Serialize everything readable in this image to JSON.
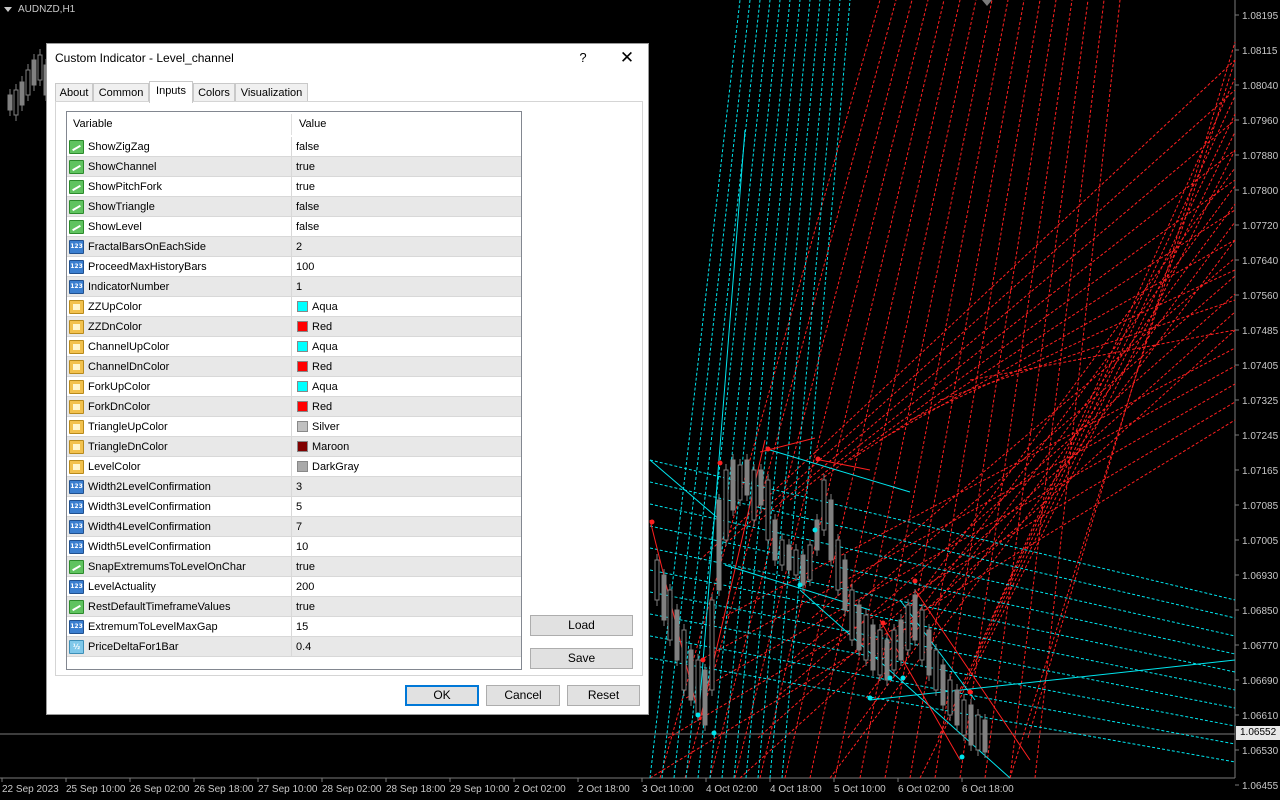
{
  "chart": {
    "symbol": "AUDNZD,H1",
    "current_price": "1.06552",
    "price_labels": [
      "1.08195",
      "1.08115",
      "1.08040",
      "1.07960",
      "1.07880",
      "1.07800",
      "1.07720",
      "1.07640",
      "1.07560",
      "1.07485",
      "1.07405",
      "1.07325",
      "1.07245",
      "1.07165",
      "1.07085",
      "1.07005",
      "1.06930",
      "1.06850",
      "1.06770",
      "1.06690",
      "1.06610",
      "1.06530",
      "1.06455"
    ],
    "time_labels": [
      "22 Sep 2023",
      "25 Sep 10:00",
      "26 Sep 02:00",
      "26 Sep 18:00",
      "27 Sep 10:00",
      "28 Sep 02:00",
      "28 Sep 18:00",
      "29 Sep 10:00",
      "2 Oct 02:00",
      "2 Oct 18:00",
      "3 Oct 10:00",
      "4 Oct 02:00",
      "4 Oct 18:00",
      "5 Oct 10:00",
      "6 Oct 02:00",
      "6 Oct 18:00"
    ],
    "colors": {
      "up": "#00e5ee",
      "down": "#ff2020",
      "candle": "#808080",
      "background": "#000000"
    }
  },
  "dialog": {
    "title": "Custom Indicator - Level_channel",
    "help": "?",
    "close": "✕",
    "tabs": [
      "About",
      "Common",
      "Inputs",
      "Colors",
      "Visualization"
    ],
    "active_tab": "Inputs",
    "grid": {
      "col_variable": "Variable",
      "col_value": "Value",
      "rows": [
        {
          "type": "bool",
          "name": "ShowZigZag",
          "value": "false"
        },
        {
          "type": "bool",
          "name": "ShowChannel",
          "value": "true"
        },
        {
          "type": "bool",
          "name": "ShowPitchFork",
          "value": "true"
        },
        {
          "type": "bool",
          "name": "ShowTriangle",
          "value": "false"
        },
        {
          "type": "bool",
          "name": "ShowLevel",
          "value": "false"
        },
        {
          "type": "int",
          "name": "FractalBarsOnEachSide",
          "value": "2"
        },
        {
          "type": "int",
          "name": "ProceedMaxHistoryBars",
          "value": "100"
        },
        {
          "type": "int",
          "name": "IndicatorNumber",
          "value": "1"
        },
        {
          "type": "color",
          "name": "ZZUpColor",
          "value": "Aqua",
          "swatch": "#00ffff"
        },
        {
          "type": "color",
          "name": "ZZDnColor",
          "value": "Red",
          "swatch": "#ff0000"
        },
        {
          "type": "color",
          "name": "ChannelUpColor",
          "value": "Aqua",
          "swatch": "#00ffff"
        },
        {
          "type": "color",
          "name": "ChannelDnColor",
          "value": "Red",
          "swatch": "#ff0000"
        },
        {
          "type": "color",
          "name": "ForkUpColor",
          "value": "Aqua",
          "swatch": "#00ffff"
        },
        {
          "type": "color",
          "name": "ForkDnColor",
          "value": "Red",
          "swatch": "#ff0000"
        },
        {
          "type": "color",
          "name": "TriangleUpColor",
          "value": "Silver",
          "swatch": "#c0c0c0"
        },
        {
          "type": "color",
          "name": "TriangleDnColor",
          "value": "Maroon",
          "swatch": "#800000"
        },
        {
          "type": "color",
          "name": "LevelColor",
          "value": "DarkGray",
          "swatch": "#a9a9a9"
        },
        {
          "type": "int",
          "name": "Width2LevelConfirmation",
          "value": "3"
        },
        {
          "type": "int",
          "name": "Width3LevelConfirmation",
          "value": "5"
        },
        {
          "type": "int",
          "name": "Width4LevelConfirmation",
          "value": "7"
        },
        {
          "type": "int",
          "name": "Width5LevelConfirmation",
          "value": "10"
        },
        {
          "type": "bool",
          "name": "SnapExtremumsToLevelOnChar",
          "value": "true"
        },
        {
          "type": "int",
          "name": "LevelActuality",
          "value": "200"
        },
        {
          "type": "bool",
          "name": "RestDefaultTimeframeValues",
          "value": "true"
        },
        {
          "type": "int",
          "name": "ExtremumToLevelMaxGap",
          "value": "15"
        },
        {
          "type": "double",
          "name": "PriceDeltaFor1Bar",
          "value": "0.4"
        }
      ]
    },
    "buttons": {
      "load": "Load",
      "save": "Save",
      "ok": "OK",
      "cancel": "Cancel",
      "reset": "Reset"
    }
  }
}
